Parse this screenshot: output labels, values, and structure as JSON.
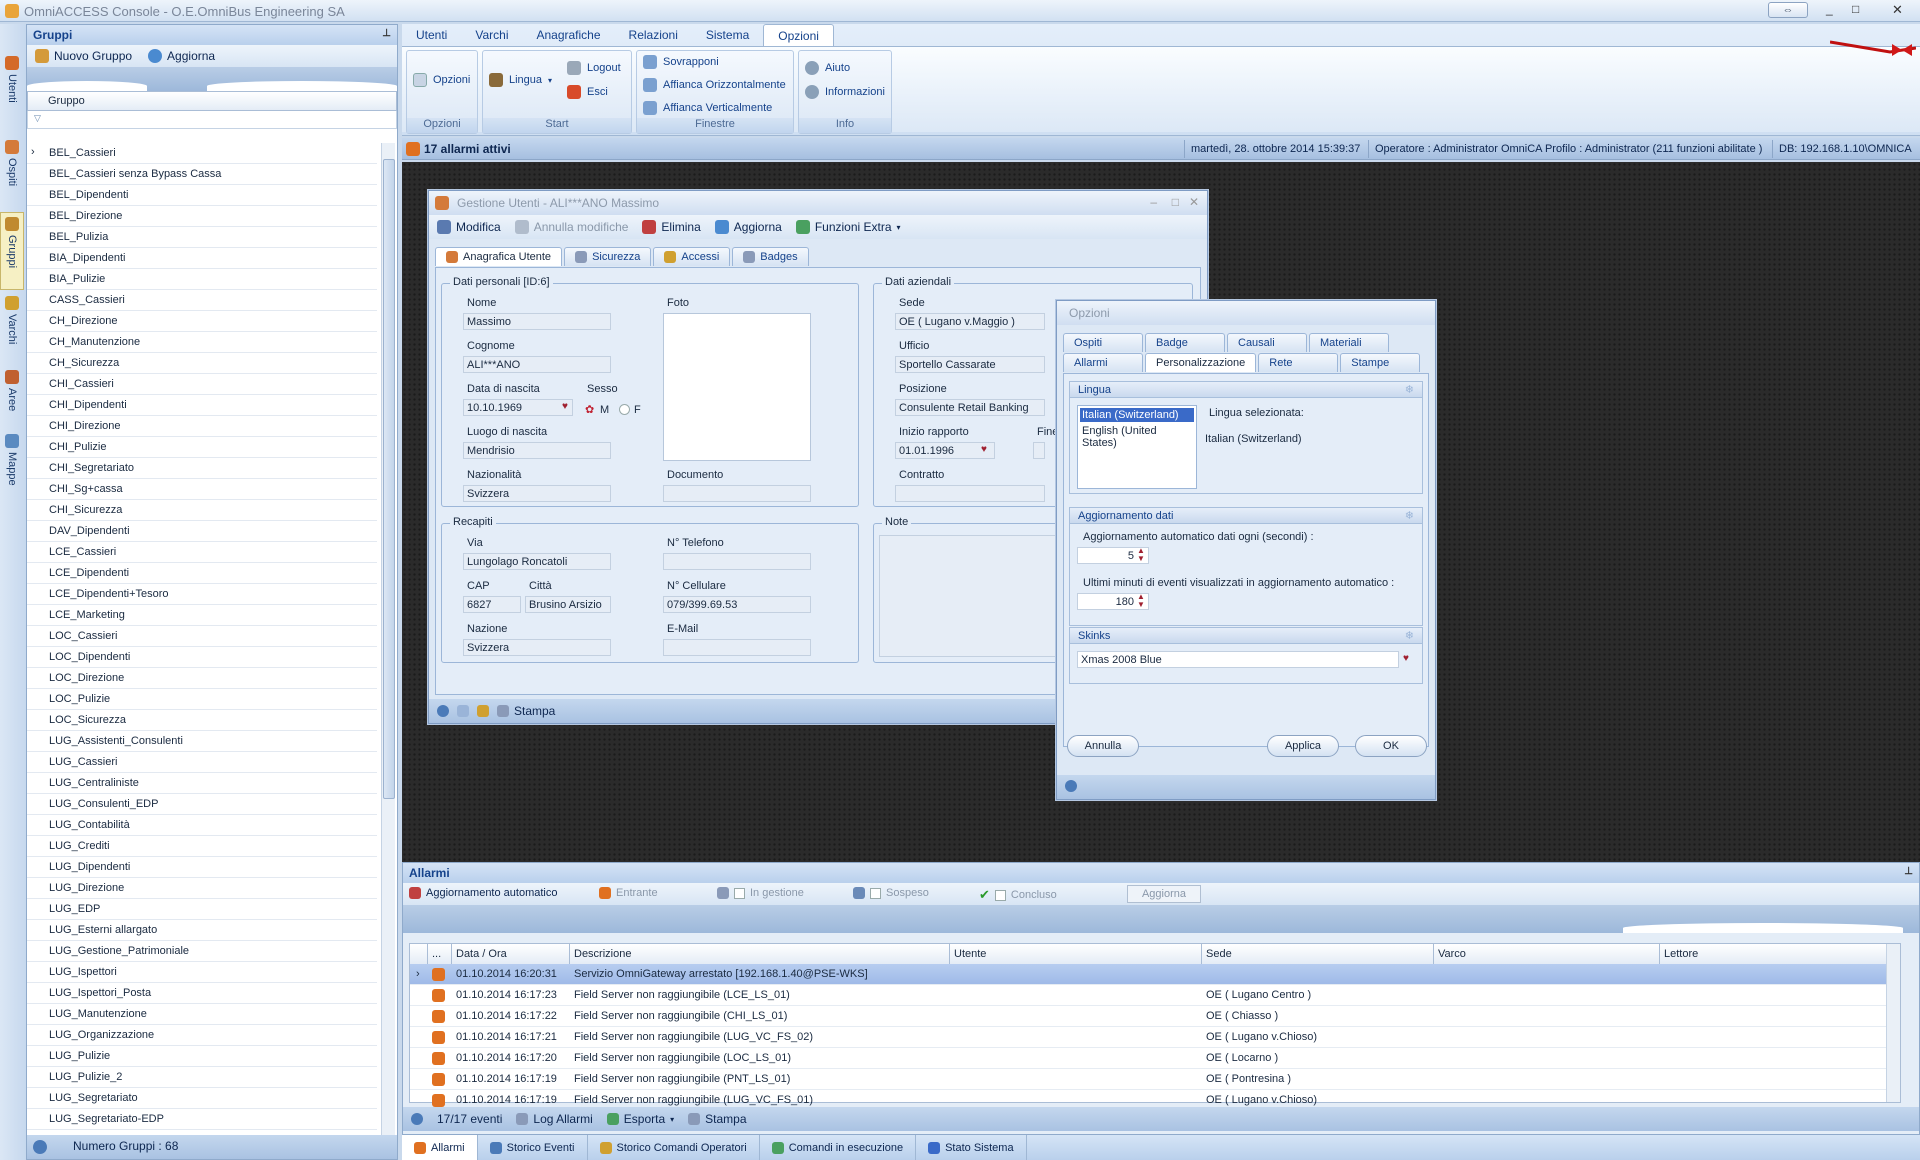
{
  "window": {
    "title": "OmniACCESS Console - O.E.OmniBus Engineering SA"
  },
  "colors": {
    "accent": "#15428b",
    "desk": "#2b2b2b",
    "selected_row": "#9fbae8",
    "alarm_icon": "#e07020"
  },
  "vtabs": [
    "Utenti",
    "Ospiti",
    "Gruppi",
    "Varchi",
    "Aree",
    "Mappe"
  ],
  "groups": {
    "title": "Gruppi",
    "toolbar": {
      "new": "Nuovo Gruppo",
      "refresh": "Aggiorna"
    },
    "column": "Gruppo",
    "items": [
      "BEL_Cassieri",
      "BEL_Cassieri senza Bypass Cassa",
      "BEL_Dipendenti",
      "BEL_Direzione",
      "BEL_Pulizia",
      "BIA_Dipendenti",
      "BIA_Pulizie",
      "CASS_Cassieri",
      "CH_Direzione",
      "CH_Manutenzione",
      "CH_Sicurezza",
      "CHI_Cassieri",
      "CHI_Dipendenti",
      "CHI_Direzione",
      "CHI_Pulizie",
      "CHI_Segretariato",
      "CHI_Sg+cassa",
      "CHI_Sicurezza",
      "DAV_Dipendenti",
      "LCE_Cassieri",
      "LCE_Dipendenti",
      "LCE_Dipendenti+Tesoro",
      "LCE_Marketing",
      "LOC_Cassieri",
      "LOC_Dipendenti",
      "LOC_Direzione",
      "LOC_Pulizie",
      "LOC_Sicurezza",
      "LUG_Assistenti_Consulenti",
      "LUG_Cassieri",
      "LUG_Centraliniste",
      "LUG_Consulenti_EDP",
      "LUG_Contabilità",
      "LUG_Crediti",
      "LUG_Dipendenti",
      "LUG_Direzione",
      "LUG_EDP",
      "LUG_Esterni allargato",
      "LUG_Gestione_Patrimoniale",
      "LUG_Ispettori",
      "LUG_Ispettori_Posta",
      "LUG_Manutenzione",
      "LUG_Organizzazione",
      "LUG_Pulizie",
      "LUG_Pulizie_2",
      "LUG_Segretariato",
      "LUG_Segretariato-EDP"
    ],
    "footer": "Numero Gruppi : 68"
  },
  "ribbon": {
    "tabs": [
      "Utenti",
      "Varchi",
      "Anagrafiche",
      "Relazioni",
      "Sistema",
      "Opzioni"
    ],
    "active_tab": "Opzioni",
    "groups": {
      "opzioni": {
        "label": "Opzioni",
        "btn": "Opzioni"
      },
      "start": {
        "label": "Start",
        "lingua": "Lingua",
        "logout": "Logout",
        "esci": "Esci"
      },
      "finestre": {
        "label": "Finestre",
        "sovrapponi": "Sovrapponi",
        "orizz": "Affianca Orizzontalmente",
        "vert": "Affianca Verticalmente"
      },
      "info": {
        "label": "Info",
        "aiuto": "Aiuto",
        "informazioni": "Informazioni"
      }
    }
  },
  "status": {
    "alarms": "17  allarmi attivi",
    "datetime": "martedì, 28. ottobre 2014  15:39:37",
    "operator": "Operatore : Administrator OmniCA   Profilo : Administrator (211  funzioni abilitate )",
    "db": "DB: 192.168.1.10\\OMNICA"
  },
  "user_window": {
    "title": "Gestione Utenti - ALI***ANO Massimo",
    "toolbar": {
      "modifica": "Modifica",
      "annulla": "Annulla modifiche",
      "elimina": "Elimina",
      "aggiorna": "Aggiorna",
      "extra": "Funzioni Extra"
    },
    "tabs": [
      "Anagrafica Utente",
      "Sicurezza",
      "Accessi",
      "Badges"
    ],
    "personal": {
      "legend": "Dati personali  [ID:6]",
      "nome_label": "Nome",
      "nome": "Massimo",
      "foto_label": "Foto",
      "cognome_label": "Cognome",
      "cognome": "ALI***ANO",
      "nascita_label": "Data di nascita",
      "nascita": "10.10.1969",
      "sesso_label": "Sesso",
      "sesso_m": "M",
      "sesso_f": "F",
      "luogo_label": "Luogo di nascita",
      "luogo": "Mendrisio",
      "naz_label": "Nazionalità",
      "naz": "Svizzera",
      "doc_label": "Documento",
      "doc": ""
    },
    "company": {
      "legend": "Dati aziendali",
      "sede_label": "Sede",
      "sede": "OE ( Lugano v.Maggio )",
      "ufficio_label": "Ufficio",
      "ufficio": "Sportello Cassarate",
      "posizione_label": "Posizione",
      "posizione": "Consulente Retail Banking",
      "inizio_label": "Inizio rapporto",
      "inizio": "01.01.1996",
      "fine_label": "Fine",
      "contratto_label": "Contratto",
      "contratto": ""
    },
    "contacts": {
      "legend": "Recapiti",
      "via_label": "Via",
      "via": "Lungolago  Roncatoli",
      "tel_label": "N° Telefono",
      "tel": "",
      "cap_label": "CAP",
      "cap": "6827",
      "citta_label": "Città",
      "citta": "Brusino Arsizio",
      "cell_label": "N° Cellulare",
      "cell": "079/399.69.53",
      "nazione_label": "Nazione",
      "nazione": "Svizzera",
      "email_label": "E-Mail",
      "email": ""
    },
    "note_label": "Note",
    "footer": {
      "stampa": "Stampa"
    }
  },
  "options_window": {
    "title": "Opzioni",
    "tabs_row1": [
      "Ospiti",
      "Badge",
      "Causali",
      "Materiali"
    ],
    "tabs_row2": [
      "Allarmi",
      "Personalizzazione",
      "Rete",
      "Stampe"
    ],
    "active_tab": "Personalizzazione",
    "lingua": {
      "header": "Lingua",
      "options": [
        "Italian (Switzerland)",
        "English (United States)"
      ],
      "selected_label": "Lingua selezionata:",
      "selected": "Italian (Switzerland)"
    },
    "update": {
      "header": "Aggiornamento dati",
      "auto_label": "Aggiornamento automatico dati ogni (secondi) :",
      "auto": "5",
      "minutes_label": "Ultimi minuti di eventi visualizzati in aggiornamento automatico :",
      "minutes": "180"
    },
    "skins": {
      "header": "Skinks",
      "value": "Xmas 2008 Blue"
    },
    "buttons": {
      "annulla": "Annulla",
      "applica": "Applica",
      "ok": "OK"
    }
  },
  "alarms": {
    "title": "Allarmi",
    "toolbar": {
      "auto": "Aggiornamento automatico",
      "entrante": "Entrante",
      "gestione": "In gestione",
      "sospeso": "Sospeso",
      "concluso": "Concluso",
      "aggiorna": "Aggiorna"
    },
    "columns": [
      "...",
      "Data / Ora",
      "Descrizione",
      "Utente",
      "Sede",
      "Varco",
      "Lettore"
    ],
    "rows": [
      {
        "time": "01.10.2014 16:20:31",
        "desc": "Servizio OmniGateway arrestato [192.168.1.40@PSE-WKS]",
        "user": "",
        "site": ""
      },
      {
        "time": "01.10.2014 16:17:23",
        "desc": "Field Server non raggiungibile (LCE_LS_01)",
        "user": "",
        "site": "OE ( Lugano Centro )"
      },
      {
        "time": "01.10.2014 16:17:22",
        "desc": "Field Server non raggiungibile (CHI_LS_01)",
        "user": "",
        "site": "OE ( Chiasso )"
      },
      {
        "time": "01.10.2014 16:17:21",
        "desc": "Field Server non raggiungibile (LUG_VC_FS_02)",
        "user": "",
        "site": "OE ( Lugano v.Chioso)"
      },
      {
        "time": "01.10.2014 16:17:20",
        "desc": "Field Server non raggiungibile (LOC_LS_01)",
        "user": "",
        "site": "OE ( Locarno )"
      },
      {
        "time": "01.10.2014 16:17:19",
        "desc": "Field Server non raggiungibile (PNT_LS_01)",
        "user": "",
        "site": "OE ( Pontresina )"
      },
      {
        "time": "01.10.2014 16:17:19",
        "desc": "Field Server non raggiungibile (LUG_VC_FS_01)",
        "user": "",
        "site": "OE ( Lugano v.Chioso)"
      }
    ],
    "footer": {
      "count": "17/17  eventi",
      "log": "Log Allarmi",
      "esporta": "Esporta",
      "stampa": "Stampa"
    }
  },
  "bottom_tabs": [
    "Allarmi",
    "Storico Eventi",
    "Storico Comandi Operatori",
    "Comandi in esecuzione",
    "Stato Sistema"
  ]
}
